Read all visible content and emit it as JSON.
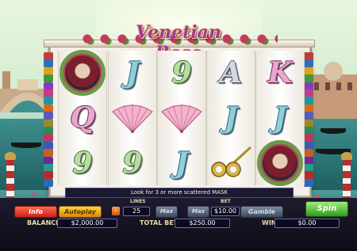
{
  "game": {
    "logo": "Venetian Rose",
    "message": "Look for 3 or more scattered MASK"
  },
  "reels": [
    [
      {
        "type": "mask",
        "name": "mask-symbol"
      },
      {
        "type": "letter",
        "text": "Q",
        "style": "pink"
      },
      {
        "type": "letter",
        "text": "9",
        "style": "green"
      }
    ],
    [
      {
        "type": "letter",
        "text": "J",
        "style": "blue"
      },
      {
        "type": "fan",
        "name": "fan-symbol"
      },
      {
        "type": "letter",
        "text": "9",
        "style": "green"
      }
    ],
    [
      {
        "type": "letter",
        "text": "9",
        "style": "green"
      },
      {
        "type": "fan",
        "name": "fan-symbol"
      },
      {
        "type": "letter",
        "text": "J",
        "style": "blue"
      }
    ],
    [
      {
        "type": "letter",
        "text": "A",
        "style": "grey"
      },
      {
        "type": "letter",
        "text": "J",
        "style": "blue"
      },
      {
        "type": "binoculars",
        "name": "opera-glasses-symbol"
      }
    ],
    [
      {
        "type": "letter",
        "text": "K",
        "style": "pink"
      },
      {
        "type": "letter",
        "text": "J",
        "style": "blue"
      },
      {
        "type": "mask",
        "name": "mask-symbol"
      }
    ]
  ],
  "controls": {
    "info_label": "Info",
    "autoplay_label": "Autoplay",
    "lines_label": "LINES",
    "lines_value": "25",
    "max_label": "Max",
    "bet_label": "BET",
    "bet_value": "$10.00",
    "gamble_label": "Gamble",
    "spin_label": "Spin",
    "balance_label": "BALANCE",
    "balance_value": "$2,000.00",
    "total_bet_label": "TOTAL BET",
    "total_bet_value": "$250.00",
    "win_label": "WIN",
    "win_value": "$0.00"
  }
}
